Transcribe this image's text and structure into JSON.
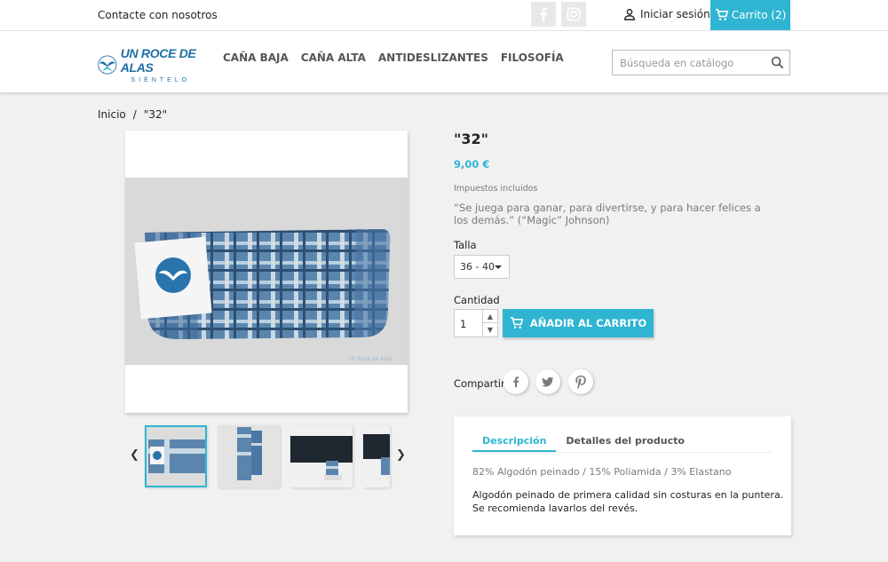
{
  "topbar": {
    "contact": "Contacte con nosotros",
    "login": "Iniciar sesión",
    "cart": "Carrito (2)"
  },
  "header": {
    "logo_title": "UN ROCE DE ALAS",
    "logo_sub": "SIÉNTELO",
    "nav": [
      "CAÑA BAJA",
      "CAÑA ALTA",
      "ANTIDESLIZANTES",
      "FILOSOFÍA"
    ],
    "search_placeholder": "Búsqueda en catálogo"
  },
  "breadcrumb": {
    "home": "Inicio",
    "separator": "/",
    "current": "\"32\""
  },
  "product": {
    "name": "\"32\"",
    "price": "9,00 €",
    "tax_note": "Impuestos incluidos",
    "quote": "“Se juega para ganar, para divertirse, y para hacer felices a los demás.” (“Magic” Johnson)",
    "size_label": "Talla",
    "size_value": "36 - 40",
    "quantity_label": "Cantidad",
    "quantity_value": "1",
    "add_to_cart": "AÑADIR AL CARRITO",
    "share_label": "Compartir",
    "watermark": "Un Roce de Alas"
  },
  "tabs": {
    "items": [
      "Descripción",
      "Detalles del producto"
    ],
    "active": 0,
    "composition": "82% Algodón peinado / 15% Poliamida / 3% Elastano",
    "description_line1": "Algodón peinado de primera calidad sin costuras en la puntera.",
    "description_line2": "Se recomienda lavarlos del revés."
  },
  "colors": {
    "accent": "#2fb5d2",
    "text": "#232323",
    "muted": "#7a7a7a",
    "background": "#f1f1f1"
  },
  "icons": [
    "facebook-icon",
    "instagram-icon",
    "user-icon",
    "cart-icon",
    "search-icon",
    "chevron-left-icon",
    "chevron-right-icon",
    "twitter-icon",
    "pinterest-icon"
  ]
}
